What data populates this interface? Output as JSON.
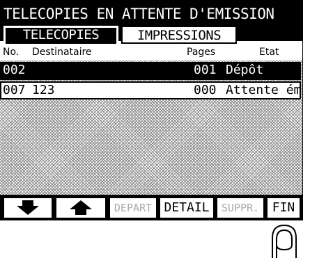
{
  "title": "TELECOPIES EN ATTENTE D'EMISSION",
  "tabs": [
    {
      "label": "TELECOPIES",
      "active": true
    },
    {
      "label": "IMPRESSIONS",
      "active": false
    }
  ],
  "columns": {
    "no": "No.",
    "dest": "Destinataire",
    "pages": "Pages",
    "etat": "Etat"
  },
  "rows": [
    {
      "no": "002",
      "dest": "",
      "pages": "001",
      "etat": "Dépôt",
      "selected": true
    },
    {
      "no": "007",
      "dest": "123",
      "pages": "000",
      "etat": "Attente ém",
      "selected": false
    }
  ],
  "buttons": {
    "down": "down-arrow-icon",
    "up": "up-arrow-icon",
    "depart": "DEPART",
    "detail": "DETAIL",
    "suppr": "SUPPR.",
    "fin": "FIN"
  },
  "colors": {
    "screen": "#000000",
    "background": "#ffffff",
    "disabled": "#aaaaaa"
  }
}
